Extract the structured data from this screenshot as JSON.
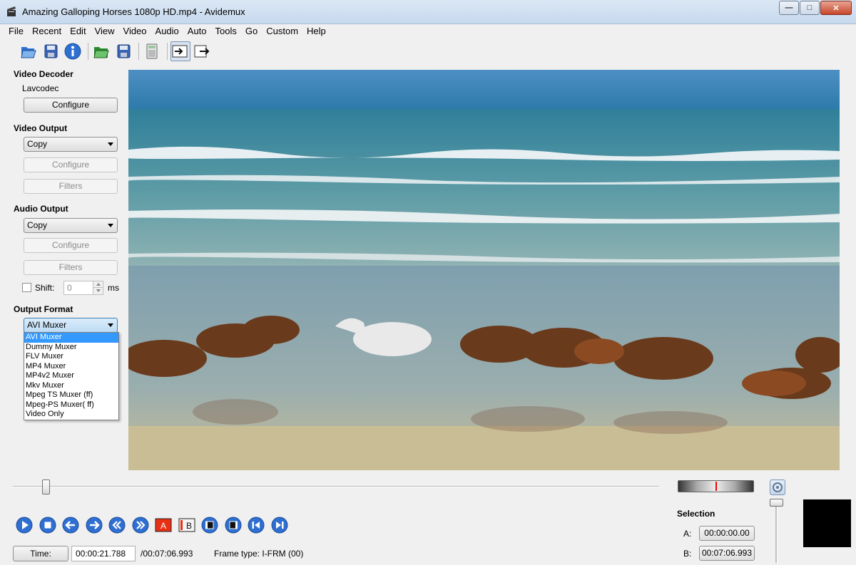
{
  "window": {
    "title": "Amazing Galloping Horses 1080p HD.mp4 - Avidemux",
    "controls": {
      "minimize": "—",
      "maximize": "□",
      "close": "✕"
    }
  },
  "menubar": [
    "File",
    "Recent",
    "Edit",
    "View",
    "Video",
    "Audio",
    "Auto",
    "Tools",
    "Go",
    "Custom",
    "Help"
  ],
  "toolbar": {
    "buttons": [
      "open-icon",
      "save-icon",
      "info-icon",
      "open-folder-icon",
      "save-video-icon",
      "calculator-icon",
      "preview-input-icon",
      "preview-output-icon"
    ]
  },
  "left_panel": {
    "video_decoder": {
      "title": "Video Decoder",
      "codec": "Lavcodec",
      "configure": "Configure"
    },
    "video_output": {
      "title": "Video Output",
      "selected": "Copy",
      "configure": "Configure",
      "filters": "Filters"
    },
    "audio_output": {
      "title": "Audio Output",
      "selected": "Copy",
      "configure": "Configure",
      "filters": "Filters"
    },
    "shift": {
      "label": "Shift:",
      "value": "0",
      "unit": "ms"
    },
    "output_format": {
      "title": "Output Format",
      "selected": "AVI Muxer",
      "options": [
        "AVI Muxer",
        "Dummy Muxer",
        "FLV Muxer",
        "MP4 Muxer",
        "MP4v2 Muxer",
        "Mkv Muxer",
        "Mpeg TS Muxer (ff)",
        "Mpeg-PS Muxer( ff)",
        "Video Only"
      ]
    }
  },
  "playback": {
    "controls": [
      "play-icon",
      "stop-icon",
      "previous-frame-icon",
      "next-frame-icon",
      "previous-keyframe-icon",
      "next-keyframe-icon",
      "set-marker-a-icon",
      "set-marker-b-icon",
      "previous-black-frame-icon",
      "next-black-frame-icon",
      "go-to-first-frame-icon",
      "go-to-last-frame-icon"
    ],
    "marker_a": "A",
    "marker_b": "B",
    "position_fraction": 0.051
  },
  "selection": {
    "title": "Selection",
    "a_label": "A:",
    "a_value": "00:00:00.00",
    "b_label": "B:",
    "b_value": "00:07:06.993"
  },
  "status": {
    "time_button": "Time:",
    "current_time": "00:00:21.788",
    "total_time": "/00:07:06.993",
    "frame_type": "Frame type:  I-FRM (00)"
  },
  "colors": {
    "accent_blue": "#3399ff",
    "control_blue": "#2f6fd1",
    "marker_red": "#e83015"
  }
}
